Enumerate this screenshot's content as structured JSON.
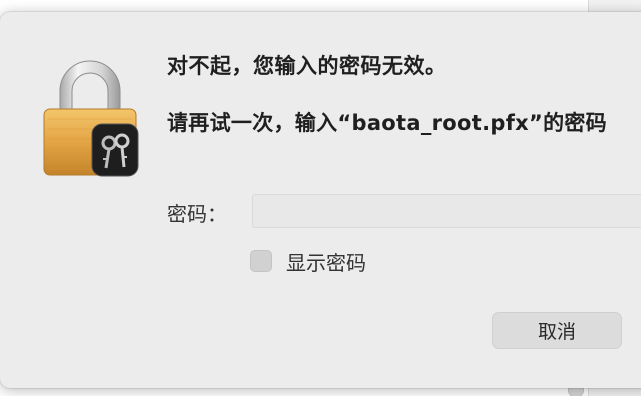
{
  "dialog": {
    "title": "对不起，您输入的密码无效。",
    "message": "请再试一次，输入“baota_root.pfx”的密码",
    "password_label": "密码：",
    "password_value": "",
    "show_password_label": "显示密码",
    "show_password_checked": false,
    "cancel_label": "取消"
  },
  "icons": {
    "lock": "keychain-lock-icon",
    "keys": "keys-icon"
  },
  "colors": {
    "dialog_background": "#ececec",
    "lock_gold": "#e3a545",
    "lock_silver": "#c9c9c9",
    "text": "#1f1f1f"
  }
}
